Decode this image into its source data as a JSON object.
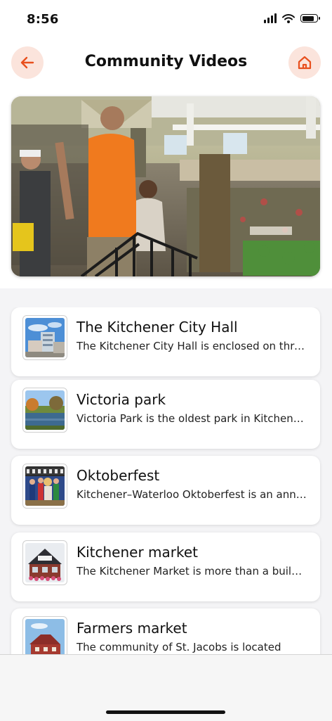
{
  "status_bar": {
    "time": "8:56"
  },
  "header": {
    "title": "Community Videos",
    "back_icon": "arrow-left-icon",
    "home_icon": "home-icon"
  },
  "colors": {
    "accent": "#e8501e",
    "accent_bg": "#fbe4dc"
  },
  "videos": [
    {
      "title": "The Kitchener City Hall",
      "description": "The Kitchener City Hall is enclosed on three sides...",
      "thumbnail": "city-hall-photo"
    },
    {
      "title": "Victoria park",
      "description": "Victoria Park is the oldest park in Kitchener...",
      "thumbnail": "park-photo"
    },
    {
      "title": "Oktoberfest",
      "description": "Kitchener–Waterloo Oktoberfest is an annual festival...",
      "thumbnail": "oktoberfest-photo"
    },
    {
      "title": "Kitchener market",
      "description": "The Kitchener Market is more than a building...",
      "thumbnail": "market-photo"
    },
    {
      "title": "Farmers market",
      "description": "The community of St. Jacobs is located",
      "thumbnail": "farmers-market-photo"
    }
  ]
}
